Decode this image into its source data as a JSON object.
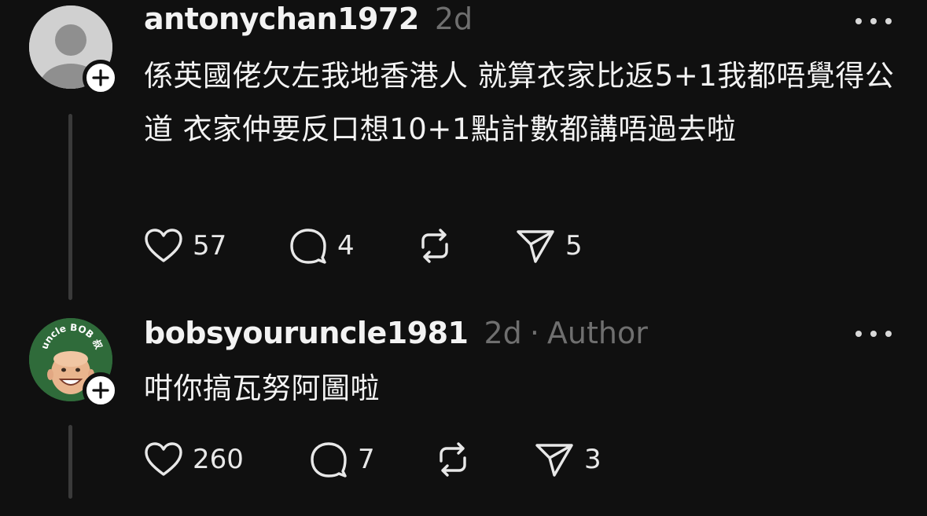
{
  "colors": {
    "background": "#101010",
    "text": "#f3f3f3",
    "muted": "#6f6f6f",
    "thread_line": "#3a3a3a",
    "bob_avatar_bg": "#2f6b3a"
  },
  "posts": [
    {
      "username": "antonychan1972",
      "time": "2d",
      "author_label": "",
      "text": "係英國佬欠左我地香港人 就算衣家比返5+1我都唔覺得公道 衣家仲要反口想10+1點計數都講唔過去啦",
      "avatar_icon": "default-avatar-icon",
      "likes": "57",
      "replies": "4",
      "reposts": "",
      "shares": "5"
    },
    {
      "username": "bobsyouruncle1981",
      "time": "2d",
      "author_label": "Author",
      "avatar_text": "uncle BOB 叔",
      "text": "咁你搞瓦努阿圖啦",
      "avatar_icon": "profile-photo",
      "likes": "260",
      "replies": "7",
      "reposts": "",
      "shares": "3"
    }
  ],
  "icons": {
    "like": "heart-icon",
    "reply": "comment-icon",
    "repost": "repost-icon",
    "share": "send-icon",
    "more": "more-dots-icon",
    "follow": "plus-icon"
  }
}
